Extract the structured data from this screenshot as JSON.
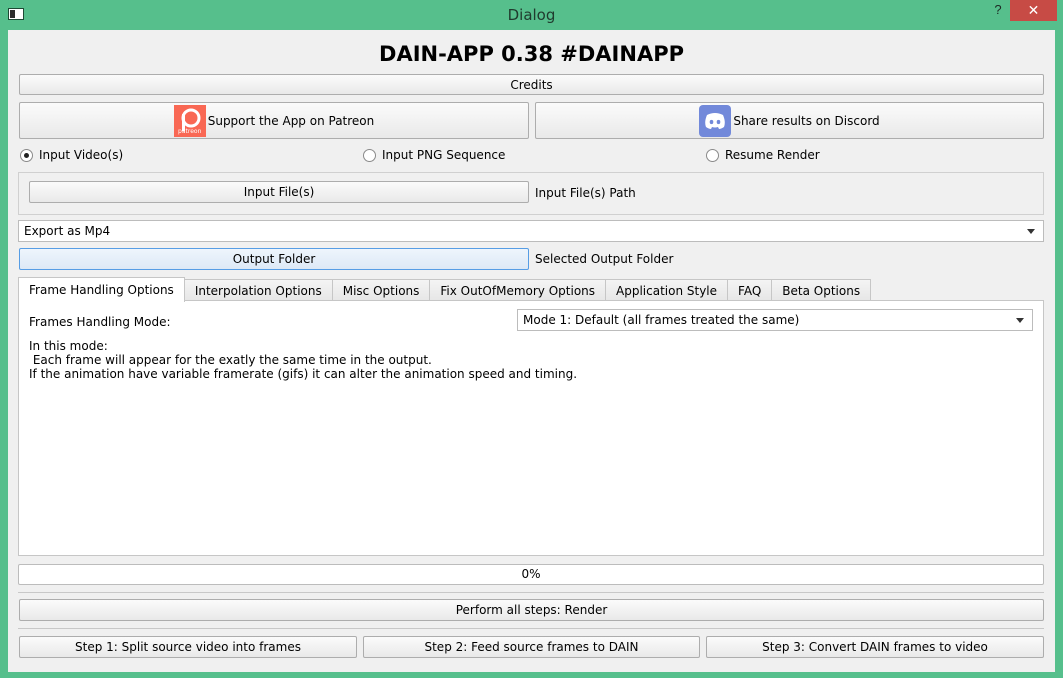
{
  "window": {
    "title": "Dialog",
    "help_label": "?",
    "close_label": "✕"
  },
  "heading": "DAIN-APP 0.38 #DAINAPP",
  "credits_button": "Credits",
  "patreon_button": "Support the App on Patreon",
  "patreon_logo_text": "patreon",
  "discord_button": "Share results on Discord",
  "input_mode": {
    "options": [
      "Input Video(s)",
      "Input PNG Sequence",
      "Resume Render"
    ],
    "selected": "Input Video(s)"
  },
  "input_files_button": "Input File(s)",
  "input_path_label": "Input File(s) Path",
  "export_format": "Export as Mp4",
  "output_folder_button": "Output Folder",
  "output_folder_label": "Selected Output Folder",
  "tabs": [
    "Frame Handling Options",
    "Interpolation Options",
    "Misc Options",
    "Fix OutOfMemory Options",
    "Application Style",
    "FAQ",
    "Beta Options"
  ],
  "active_tab": "Frame Handling Options",
  "frame_handling": {
    "mode_label": "Frames Handling Mode:",
    "mode_value": "Mode 1: Default (all frames treated the same)",
    "description": "In this mode:\n Each frame will appear for the exatly the same time in the output.\nIf the animation have variable framerate (gifs) it can alter the animation speed and timing."
  },
  "progress": {
    "value": 0,
    "label": "0%"
  },
  "render_button": "Perform all steps: Render",
  "step1_button": "Step 1: Split source video into frames",
  "step2_button": "Step 2: Feed source frames to DAIN",
  "step3_button": "Step 3: Convert DAIN frames to video",
  "colors": {
    "window_frame": "#56bf8c",
    "close_button": "#c74b45",
    "patreon": "#f96854",
    "discord": "#7289da",
    "focus_border": "#569de5"
  }
}
